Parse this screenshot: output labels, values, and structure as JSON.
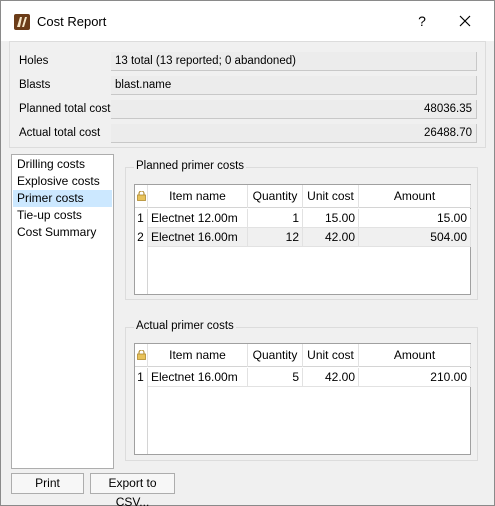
{
  "window": {
    "title": "Cost Report"
  },
  "titlebar": {
    "help_label": "?",
    "icons": {
      "app": "app-logo-icon",
      "close": "close-icon"
    }
  },
  "info": {
    "holes_label": "Holes",
    "holes_value": "13 total (13 reported; 0 abandoned)",
    "blasts_label": "Blasts",
    "blasts_value": "blast.name",
    "planned_label": "Planned total cost",
    "planned_value": "48036.35",
    "actual_label": "Actual total cost",
    "actual_value": "26488.70"
  },
  "nav": {
    "items": [
      {
        "label": "Drilling costs"
      },
      {
        "label": "Explosive costs"
      },
      {
        "label": "Primer costs"
      },
      {
        "label": "Tie-up costs"
      },
      {
        "label": "Cost Summary"
      }
    ],
    "selected": "Primer costs"
  },
  "planned": {
    "title": "Planned primer costs",
    "columns": [
      "Item name",
      "Quantity",
      "Unit cost",
      "Amount"
    ],
    "rows": [
      {
        "num": "1",
        "item": "Electnet 12.00m",
        "qty": "1",
        "unit": "15.00",
        "amount": "15.00"
      },
      {
        "num": "2",
        "item": "Electnet 16.00m",
        "qty": "12",
        "unit": "42.00",
        "amount": "504.00"
      }
    ]
  },
  "actual": {
    "title": "Actual primer costs",
    "columns": [
      "Item name",
      "Quantity",
      "Unit cost",
      "Amount"
    ],
    "rows": [
      {
        "num": "1",
        "item": "Electnet 16.00m",
        "qty": "5",
        "unit": "42.00",
        "amount": "210.00"
      }
    ]
  },
  "buttons": {
    "print": "Print",
    "export": "Export to CSV..."
  },
  "colors": {
    "selection": "#cce8ff",
    "app_icon": "#6b3c18"
  }
}
